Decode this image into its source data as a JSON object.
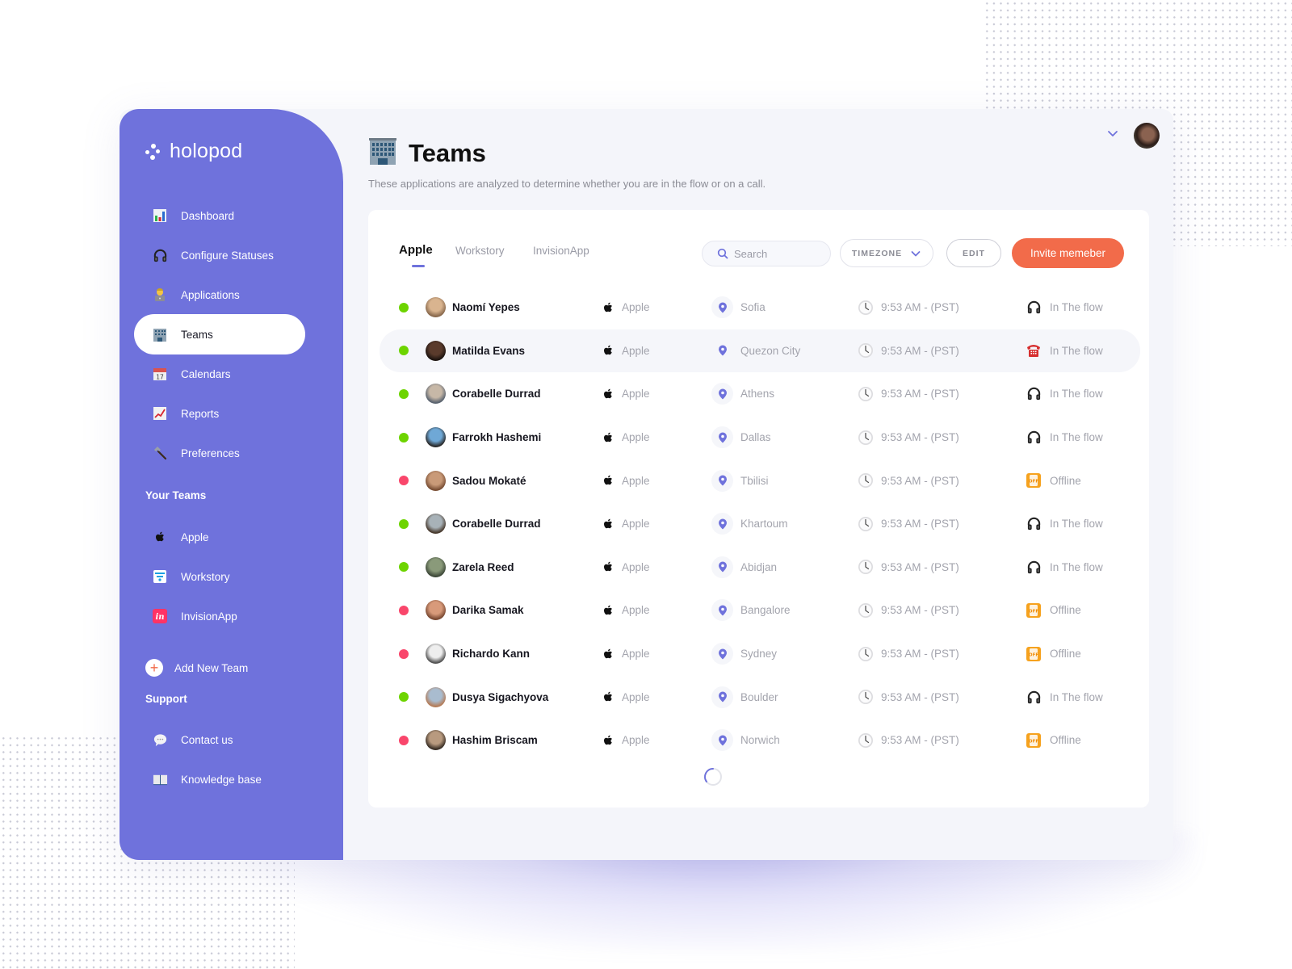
{
  "brand": {
    "name": "holopod",
    "accent": "#6f72dc",
    "cta_color": "#f26b4a"
  },
  "sidebar": {
    "nav": [
      {
        "label": "Dashboard",
        "icon": "bar-chart-icon",
        "active": false
      },
      {
        "label": "Configure Statuses",
        "icon": "headphones-icon",
        "active": false
      },
      {
        "label": "Applications",
        "icon": "technologist-icon",
        "active": false
      },
      {
        "label": "Teams",
        "icon": "office-building-icon",
        "active": true
      },
      {
        "label": "Calendars",
        "icon": "calendar-icon",
        "active": false
      },
      {
        "label": "Reports",
        "icon": "chart-increasing-icon",
        "active": false
      },
      {
        "label": "Preferences",
        "icon": "hammer-icon",
        "active": false
      }
    ],
    "your_teams_title": "Your Teams",
    "teams": [
      {
        "label": "Apple",
        "icon": "apple-logo-icon"
      },
      {
        "label": "Workstory",
        "icon": "workstory-logo-icon"
      },
      {
        "label": "InvisionApp",
        "icon": "invision-logo-icon"
      }
    ],
    "add_team_label": "Add New Team",
    "support_title": "Support",
    "support": [
      {
        "label": "Contact us",
        "icon": "speech-bubble-icon"
      },
      {
        "label": "Knowledge base",
        "icon": "open-book-icon"
      }
    ]
  },
  "header": {
    "title": "Teams",
    "subtitle": "These applications are analyzed to determine whether you are in the flow or on a call."
  },
  "toolbar": {
    "tabs": [
      {
        "label": "Apple",
        "active": true
      },
      {
        "label": "Workstory",
        "active": false
      },
      {
        "label": "InvisionApp",
        "active": false
      }
    ],
    "search_placeholder": "Search",
    "search_value": "",
    "timezone_label": "TIMEZONE",
    "edit_label": "EDIT",
    "invite_label": "Invite memeber"
  },
  "members": [
    {
      "name": "Naomí Yepes",
      "online": true,
      "team": "Apple",
      "location": "Sofia",
      "time": "9:53 AM - (PST)",
      "status": "In The flow",
      "status_icon": "headphones"
    },
    {
      "name": "Matilda Evans",
      "online": true,
      "team": "Apple",
      "location": "Quezon City",
      "time": "9:53 AM - (PST)",
      "status": "In The flow",
      "status_icon": "telephone",
      "highlighted": true
    },
    {
      "name": "Corabelle Durrad",
      "online": true,
      "team": "Apple",
      "location": "Athens",
      "time": "9:53 AM - (PST)",
      "status": "In The flow",
      "status_icon": "headphones"
    },
    {
      "name": "Farrokh Hashemi",
      "online": true,
      "team": "Apple",
      "location": "Dallas",
      "time": "9:53 AM - (PST)",
      "status": "In The flow",
      "status_icon": "headphones"
    },
    {
      "name": "Sadou Mokaté",
      "online": false,
      "team": "Apple",
      "location": "Tbilisi",
      "time": "9:53 AM - (PST)",
      "status": "Offline",
      "status_icon": "mobile-off"
    },
    {
      "name": "Corabelle Durrad",
      "online": true,
      "team": "Apple",
      "location": "Khartoum",
      "time": "9:53 AM - (PST)",
      "status": "In The flow",
      "status_icon": "headphones"
    },
    {
      "name": "Zarela Reed",
      "online": true,
      "team": "Apple",
      "location": "Abidjan",
      "time": "9:53 AM - (PST)",
      "status": "In The flow",
      "status_icon": "headphones"
    },
    {
      "name": "Darika Samak",
      "online": false,
      "team": "Apple",
      "location": "Bangalore",
      "time": "9:53 AM - (PST)",
      "status": "Offline",
      "status_icon": "mobile-off"
    },
    {
      "name": "Richardo Kann",
      "online": false,
      "team": "Apple",
      "location": "Sydney",
      "time": "9:53 AM - (PST)",
      "status": "Offline",
      "status_icon": "mobile-off"
    },
    {
      "name": "Dusya Sigachyova",
      "online": true,
      "team": "Apple",
      "location": "Boulder",
      "time": "9:53 AM - (PST)",
      "status": "In The flow",
      "status_icon": "headphones"
    },
    {
      "name": "Hashim Briscam",
      "online": false,
      "team": "Apple",
      "location": "Norwich",
      "time": "9:53 AM - (PST)",
      "status": "Offline",
      "status_icon": "mobile-off"
    }
  ],
  "status_colors": {
    "online": "#6dd400",
    "offline": "#f9466b"
  }
}
